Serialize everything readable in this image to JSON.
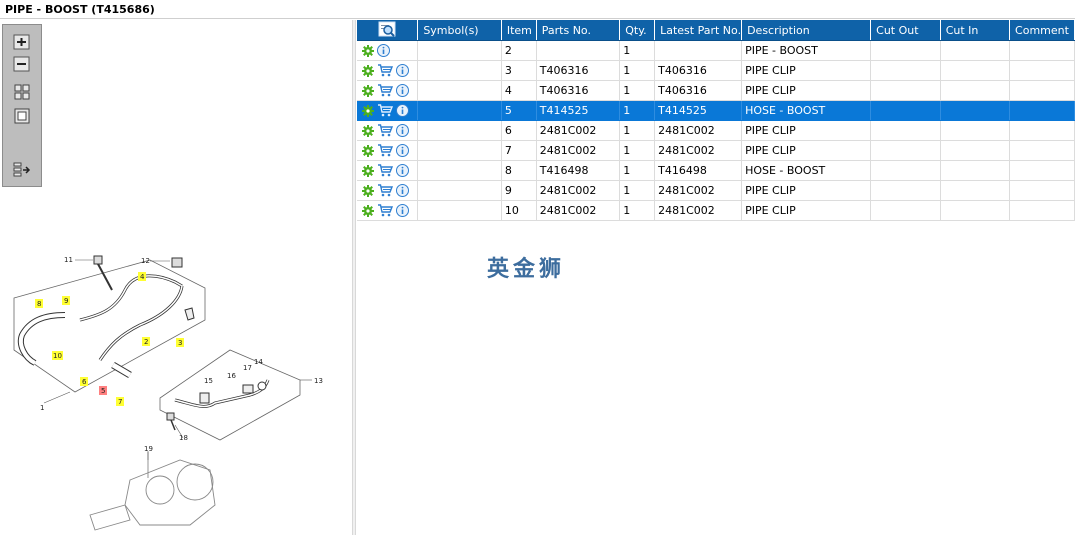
{
  "title": "PIPE - BOOST (T415686)",
  "watermark": "英金狮",
  "table": {
    "columns": [
      "",
      "Symbol(s)",
      "Item",
      "Parts No.",
      "Qty.",
      "Latest Part No.",
      "Description",
      "Cut Out",
      "Cut In",
      "Comment"
    ],
    "rows": [
      {
        "item": "2",
        "part_no": "",
        "qty": "1",
        "latest": "",
        "desc": "PIPE - BOOST",
        "cart": false,
        "selected": false
      },
      {
        "item": "3",
        "part_no": "T406316",
        "qty": "1",
        "latest": "T406316",
        "desc": "PIPE CLIP",
        "cart": true,
        "selected": false
      },
      {
        "item": "4",
        "part_no": "T406316",
        "qty": "1",
        "latest": "T406316",
        "desc": "PIPE CLIP",
        "cart": true,
        "selected": false
      },
      {
        "item": "5",
        "part_no": "T414525",
        "qty": "1",
        "latest": "T414525",
        "desc": "HOSE - BOOST",
        "cart": true,
        "selected": true
      },
      {
        "item": "6",
        "part_no": "2481C002",
        "qty": "1",
        "latest": "2481C002",
        "desc": "PIPE CLIP",
        "cart": true,
        "selected": false
      },
      {
        "item": "7",
        "part_no": "2481C002",
        "qty": "1",
        "latest": "2481C002",
        "desc": "PIPE CLIP",
        "cart": true,
        "selected": false
      },
      {
        "item": "8",
        "part_no": "T416498",
        "qty": "1",
        "latest": "T416498",
        "desc": "HOSE - BOOST",
        "cart": true,
        "selected": false
      },
      {
        "item": "9",
        "part_no": "2481C002",
        "qty": "1",
        "latest": "2481C002",
        "desc": "PIPE CLIP",
        "cart": true,
        "selected": false
      },
      {
        "item": "10",
        "part_no": "2481C002",
        "qty": "1",
        "latest": "2481C002",
        "desc": "PIPE CLIP",
        "cart": true,
        "selected": false
      }
    ]
  },
  "diagram": {
    "labels": [
      "11",
      "12",
      "4",
      "8",
      "9",
      "2",
      "3",
      "10",
      "6",
      "5",
      "7",
      "1",
      "13",
      "14",
      "15",
      "16",
      "17",
      "18",
      "19"
    ],
    "highlighted": [
      "4",
      "8",
      "9",
      "3",
      "10",
      "6",
      "7",
      "2"
    ],
    "selected_label": "5"
  },
  "colors": {
    "header": "#0f62a8",
    "selected_row": "#0a78d7",
    "gear": "#4caf1e",
    "info": "#2f7fd0",
    "highlight": "#ffff33",
    "selected_highlight": "#ff8080"
  },
  "icons": {
    "gear": "gear-icon",
    "cart": "cart-icon",
    "info": "info-icon",
    "find": "find-icon",
    "zoom_in": "zoom-in-icon",
    "zoom_out": "zoom-out-icon",
    "fit": "fit-icon",
    "actual": "actual-size-icon",
    "export": "export-icon"
  }
}
